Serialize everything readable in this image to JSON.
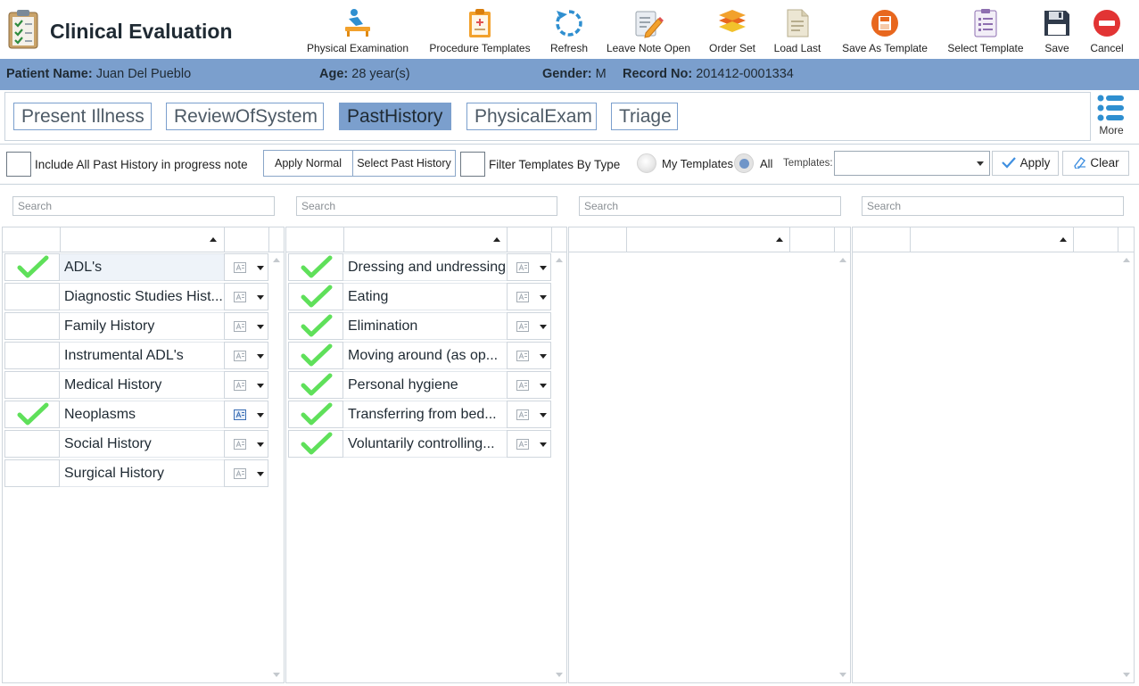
{
  "app": {
    "title": "Clinical Evaluation"
  },
  "toolbar": [
    {
      "label": "Physical Examination",
      "icon": "stretcher-icon"
    },
    {
      "label": "Procedure Templates",
      "icon": "clipboard-icon"
    },
    {
      "label": "Refresh",
      "icon": "refresh-icon"
    },
    {
      "label": "Leave Note Open",
      "icon": "note-pen-icon"
    },
    {
      "label": "Order Set",
      "icon": "layers-icon"
    },
    {
      "label": "Load Last",
      "icon": "document-icon"
    },
    {
      "label": "Save As Template",
      "icon": "save-as-icon"
    },
    {
      "label": "Select Template",
      "icon": "list-template-icon"
    },
    {
      "label": "Save",
      "icon": "floppy-icon"
    },
    {
      "label": "Cancel",
      "icon": "cancel-icon"
    }
  ],
  "patient": {
    "name_label": "Patient Name:",
    "name": "Juan Del Pueblo",
    "age_label": "Age:",
    "age": "28 year(s)",
    "gender_label": "Gender:",
    "gender": "M",
    "record_label": "Record No:",
    "record": "201412-0001334"
  },
  "tabs": [
    {
      "label": "Present Illness",
      "active": false
    },
    {
      "label": "ReviewOfSystem",
      "active": false
    },
    {
      "label": "PastHistory",
      "active": true
    },
    {
      "label": "PhysicalExam",
      "active": false
    },
    {
      "label": "Triage",
      "active": false
    }
  ],
  "more": {
    "label": "More"
  },
  "options": {
    "include_label": "Include All Past History in progress note",
    "apply_normal": "Apply Normal",
    "select_past_history": "Select Past History",
    "filter_label": "Filter Templates By Type",
    "my_templates": "My Templates",
    "all": "All",
    "templates_label": "Templates:",
    "templates_value": "",
    "apply": "Apply",
    "clear": "Clear"
  },
  "search_placeholder": "Search",
  "panels": [
    {
      "items": [
        {
          "label": "ADL's",
          "checked": true,
          "selected": true,
          "template_active": false
        },
        {
          "label": "Diagnostic Studies Hist...",
          "checked": false,
          "selected": false,
          "template_active": false
        },
        {
          "label": "Family History",
          "checked": false,
          "selected": false,
          "template_active": false
        },
        {
          "label": "Instrumental ADL's",
          "checked": false,
          "selected": false,
          "template_active": false
        },
        {
          "label": "Medical History",
          "checked": false,
          "selected": false,
          "template_active": false
        },
        {
          "label": "Neoplasms",
          "checked": true,
          "selected": false,
          "template_active": true
        },
        {
          "label": "Social History",
          "checked": false,
          "selected": false,
          "template_active": false
        },
        {
          "label": "Surgical History",
          "checked": false,
          "selected": false,
          "template_active": false
        }
      ]
    },
    {
      "items": [
        {
          "label": "Dressing and undressing",
          "checked": true,
          "selected": false,
          "template_active": false
        },
        {
          "label": "Eating",
          "checked": true,
          "selected": false,
          "template_active": false
        },
        {
          "label": "Elimination",
          "checked": true,
          "selected": false,
          "template_active": false
        },
        {
          "label": "Moving around (as op...",
          "checked": true,
          "selected": false,
          "template_active": false
        },
        {
          "label": "Personal hygiene",
          "checked": true,
          "selected": false,
          "template_active": false
        },
        {
          "label": "Transferring from bed...",
          "checked": true,
          "selected": false,
          "template_active": false
        },
        {
          "label": "Voluntarily controlling...",
          "checked": true,
          "selected": false,
          "template_active": false
        }
      ]
    },
    {
      "items": []
    },
    {
      "items": []
    }
  ],
  "colors": {
    "accent": "#7b9fcd",
    "check_green": "#5fe05a",
    "radio_dot": "#6f95c8"
  }
}
